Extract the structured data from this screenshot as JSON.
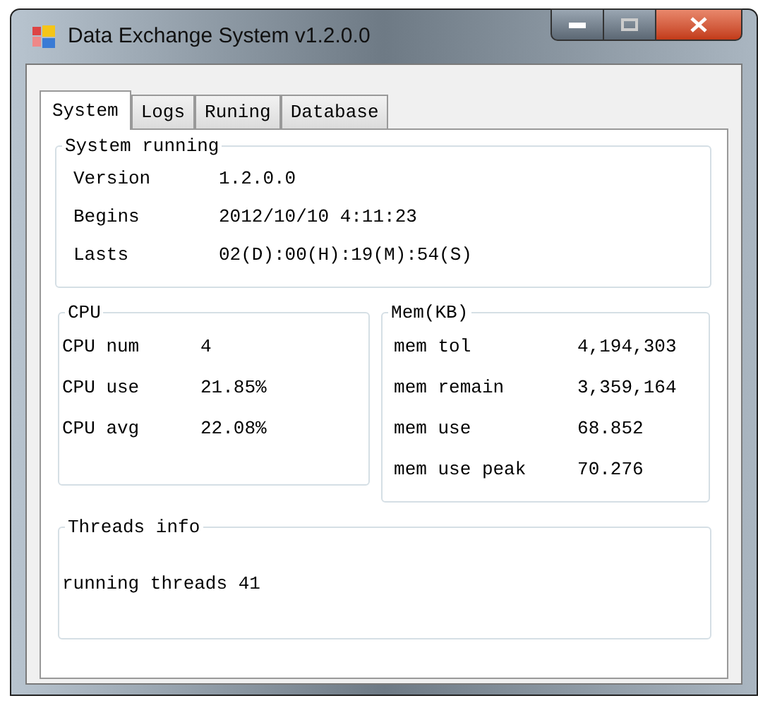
{
  "window": {
    "title": "Data Exchange System v1.2.0.0"
  },
  "tabs": [
    {
      "label": "System",
      "selected": true
    },
    {
      "label": "Logs",
      "selected": false
    },
    {
      "label": "Runing",
      "selected": false
    },
    {
      "label": "Database",
      "selected": false
    }
  ],
  "system_running": {
    "title": "System running",
    "rows": [
      {
        "label": "Version",
        "value": "1.2.0.0"
      },
      {
        "label": "Begins",
        "value": "2012/10/10 4:11:23"
      },
      {
        "label": "Lasts",
        "value": "02(D):00(H):19(M):54(S)"
      }
    ]
  },
  "cpu": {
    "title": "CPU",
    "rows": [
      {
        "label": "CPU num",
        "value": "4"
      },
      {
        "label": "CPU use",
        "value": "21.85%"
      },
      {
        "label": "CPU avg",
        "value": "22.08%"
      }
    ]
  },
  "mem": {
    "title": "Mem(KB)",
    "rows": [
      {
        "label": "mem tol",
        "value": "4,194,303"
      },
      {
        "label": "mem remain",
        "value": "3,359,164"
      },
      {
        "label": "mem use",
        "value": "68.852"
      },
      {
        "label": "mem use peak",
        "value": "70.276"
      }
    ]
  },
  "threads": {
    "title": "Threads info",
    "text": "running threads 41"
  }
}
